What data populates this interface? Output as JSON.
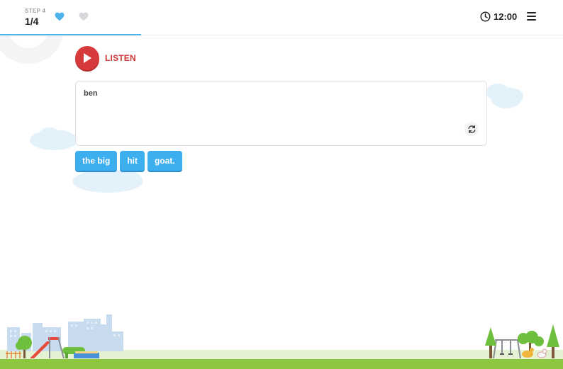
{
  "header": {
    "step_label": "STEP 4",
    "step_value": "1/4",
    "hearts": [
      {
        "icon": "heart-icon",
        "state": "filled",
        "color": "#4fb1ea"
      },
      {
        "icon": "heart-icon",
        "state": "empty",
        "color": "#d5d7da"
      }
    ],
    "timer": {
      "icon": "clock-icon",
      "value": "12:00"
    },
    "menu_icon": "hamburger-menu-icon",
    "progress": 0.25
  },
  "exercise": {
    "listen_label": "LISTEN",
    "answer_text": "ben",
    "reset_icon": "refresh-icon",
    "word_chips": [
      "the big",
      "hit",
      "goat."
    ]
  },
  "colors": {
    "accent_blue": "#3daef0",
    "listen_red": "#d63a3a",
    "grass": "#8dc63f"
  }
}
